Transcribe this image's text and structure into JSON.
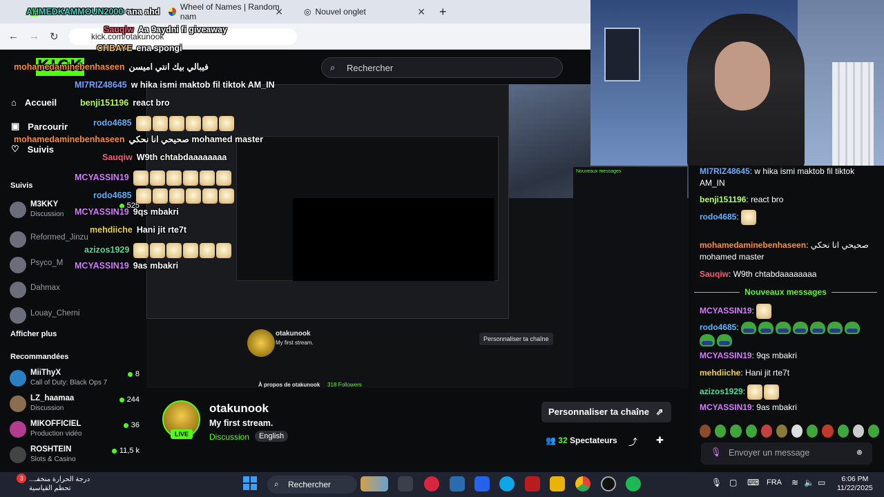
{
  "browser": {
    "tabs": [
      {
        "label": "AHMEDKAMMOUN2000"
      },
      {
        "label": "Wheel of Names | Random nam"
      },
      {
        "label": "Nouvel onglet"
      }
    ],
    "new_tab": "+",
    "url": "kick.com/otakunook"
  },
  "kick": {
    "logo": "KICK",
    "search_placeholder": "Rechercher",
    "nav": [
      {
        "label": "Accueil",
        "icon": "home-icon"
      },
      {
        "label": "Parcourir",
        "icon": "browse-icon"
      },
      {
        "label": "Suivis",
        "icon": "heart-icon"
      }
    ],
    "followed_label": "Suivis",
    "followed": [
      {
        "name": "M3KKY",
        "sub": "Discussion",
        "viewers": "525",
        "online": true
      },
      {
        "name": "Reformed_Jinzu",
        "sub": "",
        "viewers": "",
        "online": false
      },
      {
        "name": "Psyco_M",
        "sub": "",
        "viewers": "",
        "online": false
      },
      {
        "name": "Dahmax",
        "sub": "",
        "viewers": "",
        "online": false
      },
      {
        "name": "Louay_Cherni",
        "sub": "",
        "viewers": "",
        "online": false
      }
    ],
    "show_more": "Afficher plus",
    "recommended_label": "Recommandées",
    "recommended": [
      {
        "name": "MiiThyX",
        "sub": "Call of Duty: Black Ops 7",
        "viewers": "8"
      },
      {
        "name": "LZ_haamaa",
        "sub": "Discussion",
        "viewers": "244"
      },
      {
        "name": "MIKOFFICIEL",
        "sub": "Production vidéo",
        "viewers": "36"
      },
      {
        "name": "ROSHTEIN",
        "sub": "Slots & Casino",
        "viewers": "11,5 k"
      }
    ]
  },
  "stream": {
    "streamer": "otakunook",
    "live_badge": "LIVE",
    "title": "My first stream.",
    "category": "Discussion",
    "language": "English",
    "customize_button": "Personnaliser ta chaîne",
    "viewers": "32",
    "viewers_label": "Spectateurs",
    "inner_about": "À propos de otakunook",
    "inner_followers": "318 Followers"
  },
  "overlay_chat": [
    {
      "user": "AHMEDKAMMOUN2000",
      "msg": "ana ahd",
      "color": "#43d1c3"
    },
    {
      "user": "Sauqiw",
      "msg": "Aa 9aydni fi giveaway",
      "color": "#ff5a7a"
    },
    {
      "user": "CHBAYE",
      "msg": "ena spongi",
      "color": "#f0c05a"
    },
    {
      "user": "mohamedaminebenhaseen",
      "msg": "فيبالي بيك انتي اميسن",
      "color": "#ff8c3a"
    },
    {
      "user": "MI7RIZ48645",
      "msg": "w hika ismi maktob fil tiktok AM_IN",
      "color": "#6fa8ff"
    },
    {
      "user": "benji151196",
      "msg": "react bro",
      "color": "#b3ff5a"
    },
    {
      "user": "rodo4685",
      "msg": "",
      "color": "#5ab4ff"
    },
    {
      "user": "mohamedaminebenhaseen",
      "msg": "صحيحي انا نحكي mohamed master",
      "color": "#ff8c3a"
    },
    {
      "user": "Sauqiw",
      "msg": "W9th chtabdaaaaaaaa",
      "color": "#ff5a7a"
    },
    {
      "user": "MCYASSIN19",
      "msg": "",
      "color": "#d67aff"
    },
    {
      "user": "rodo4685",
      "msg": "",
      "color": "#5ab4ff"
    },
    {
      "user": "MCYASSIN19",
      "msg": "9qs mbakri",
      "color": "#d67aff"
    },
    {
      "user": "mehdiiche",
      "msg": "Hani jit rte7t",
      "color": "#f0d24a"
    },
    {
      "user": "azizos1929",
      "msg": "",
      "color": "#3fe0a0"
    },
    {
      "user": "MCYASSIN19",
      "msg": "9as mbakri",
      "color": "#d67aff"
    }
  ],
  "chat": {
    "messages": [
      {
        "user": "MI7RIZ48645",
        "msg": "w hika ismi maktob fil tiktok AM_IN",
        "color": "#6fa8ff"
      },
      {
        "user": "benji151196",
        "msg": "react bro",
        "color": "#b3ff5a"
      },
      {
        "user": "rodo4685",
        "msg": "",
        "color": "#5ab4ff"
      },
      {
        "user": "mohamedaminebenhaseen",
        "msg": "صحيحي انا نحكي mohamed master",
        "color": "#ff8c3a"
      },
      {
        "user": "Sauqiw",
        "msg": "W9th chtabdaaaaaaaa",
        "color": "#ff5a7a"
      }
    ],
    "new_messages_label": "Nouveaux messages",
    "new_messages": [
      {
        "user": "MCYASSIN19",
        "msg": "",
        "color": "#d67aff"
      },
      {
        "user": "rodo4685",
        "msg": "",
        "color": "#5ab4ff"
      },
      {
        "user": "MCYASSIN19",
        "msg": "9qs mbakri",
        "color": "#d67aff"
      },
      {
        "user": "mehdiiche",
        "msg": "Hani jit rte7t",
        "color": "#f0d24a"
      },
      {
        "user": "azizos1929",
        "msg": "",
        "color": "#3fe0a0"
      },
      {
        "user": "MCYASSIN19",
        "msg": "9as mbakri",
        "color": "#d67aff"
      }
    ],
    "input_placeholder": "Envoyer un message"
  },
  "taskbar": {
    "weather_line1": "درجة الحرارة منخفـ...",
    "weather_line2": "تحطم القياسية",
    "weather_badge": "3",
    "search": "Rechercher",
    "lang": "FRA",
    "time": "6:06 PM",
    "date": "11/22/2025"
  },
  "colors": {
    "kick_green": "#53fc18",
    "bg": "#0b0c0e",
    "panel": "#1c1d22"
  }
}
